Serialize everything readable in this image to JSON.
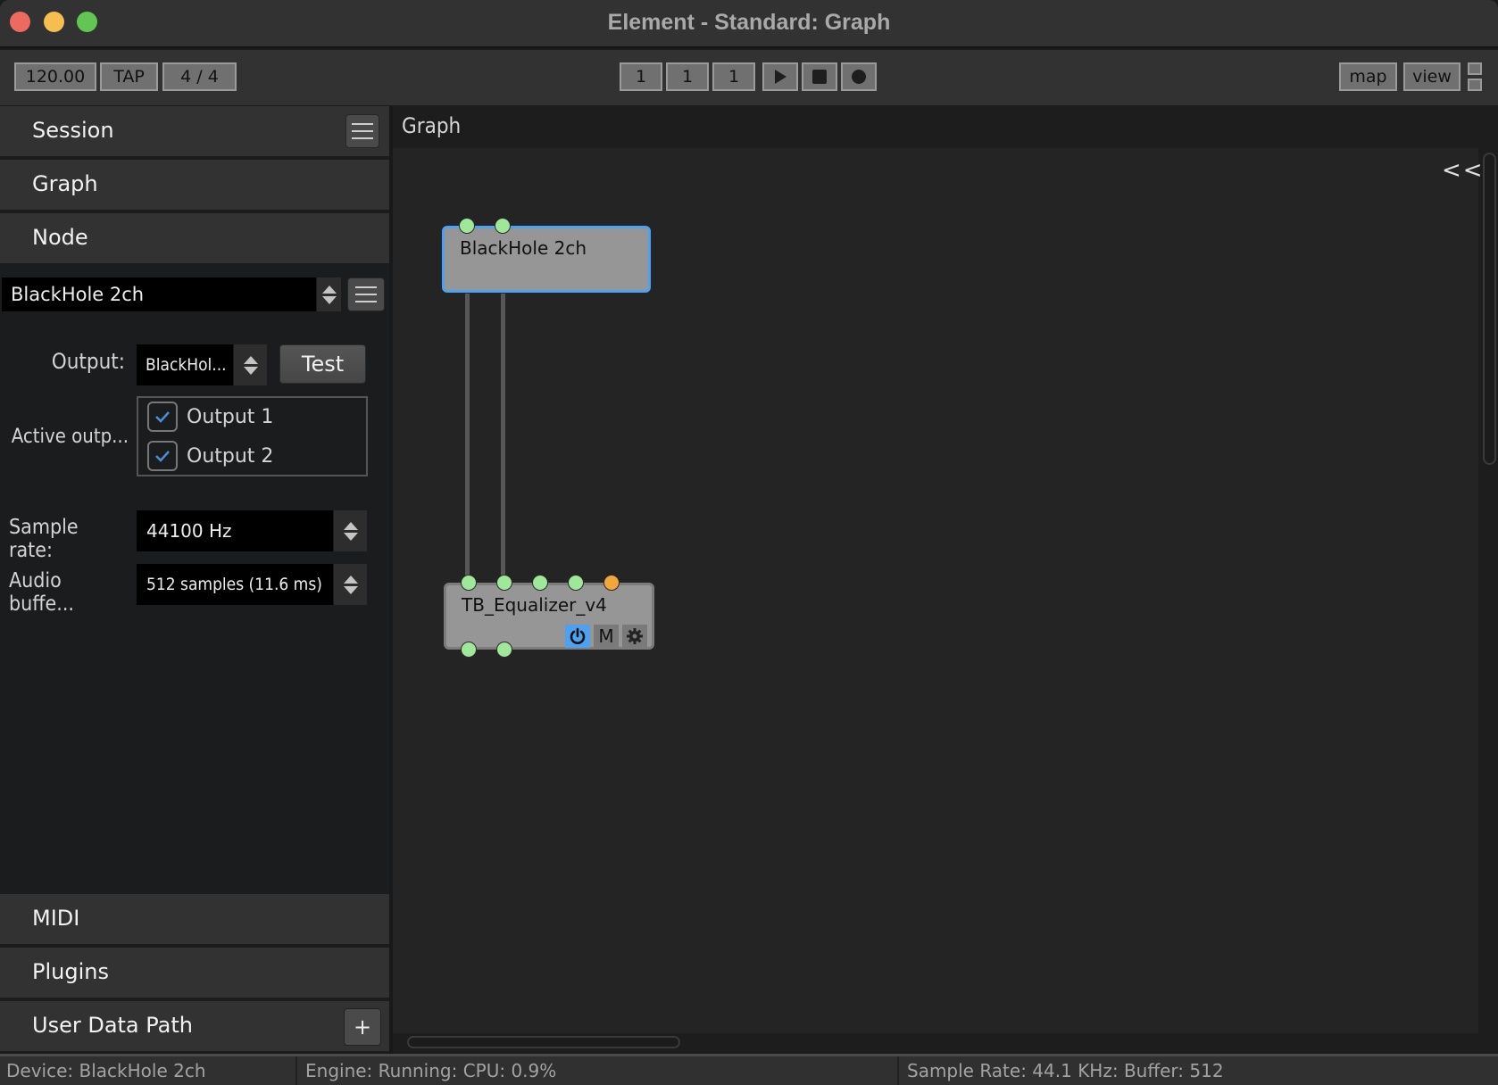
{
  "window": {
    "title": "Element - Standard: Graph"
  },
  "toolbar": {
    "tempo": "120.00",
    "tap_label": "TAP",
    "time_signature": "4 / 4",
    "bar": "1",
    "beat": "1",
    "tick": "1",
    "play_icon": "play-icon",
    "stop_icon": "stop-icon",
    "record_icon": "record-icon",
    "map_label": "map",
    "view_label": "view"
  },
  "sidebar": {
    "panels": [
      {
        "label": "Session",
        "has_menu": true
      },
      {
        "label": "Graph"
      },
      {
        "label": "Node"
      },
      {
        "label": "MIDI"
      },
      {
        "label": "Plugins"
      },
      {
        "label": "User Data Path",
        "action_label": "+"
      }
    ],
    "node_panel": {
      "selected_node": "BlackHole 2ch",
      "output_label": "Output:",
      "output_value": "BlackHol...",
      "test_label": "Test",
      "active_outputs_label": "Active outp...",
      "outputs": [
        {
          "label": "Output 1",
          "checked": true
        },
        {
          "label": "Output 2",
          "checked": true
        }
      ],
      "sample_rate_label": "Sample rate:",
      "sample_rate_value": "44100 Hz",
      "buffer_label": "Audio buffe...",
      "buffer_value": "512 samples (11.6 ms)"
    }
  },
  "graph": {
    "header": "Graph",
    "collapse_label": "<<",
    "nodes": [
      {
        "name": "BlackHole 2ch",
        "selected": true,
        "top_ports": [
          "audio",
          "audio"
        ],
        "bottom_ports": []
      },
      {
        "name": "TB_Equalizer_v4",
        "selected": false,
        "top_ports": [
          "audio",
          "audio",
          "audio",
          "audio",
          "midi"
        ],
        "bottom_ports": [
          "audio",
          "audio"
        ],
        "buttons": {
          "power": "power-icon",
          "mute": "M",
          "settings": "gear-icon"
        }
      }
    ],
    "connections": [
      {
        "from": "BlackHole 2ch:0",
        "to": "TB_Equalizer_v4:in0"
      },
      {
        "from": "BlackHole 2ch:1",
        "to": "TB_Equalizer_v4:in1"
      }
    ],
    "colors": {
      "audio_port": "#9fe89a",
      "midi_port": "#f2a73b",
      "selection": "#4ea1f0",
      "power_on": "#4ea1f0"
    }
  },
  "status": {
    "device": "Device: BlackHole 2ch",
    "engine": "Engine: Running:  CPU: 0.9%",
    "audio": "Sample Rate: 44.1 KHz:  Buffer: 512"
  }
}
